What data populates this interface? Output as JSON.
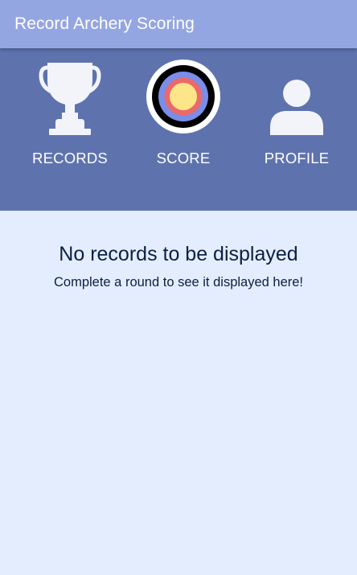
{
  "app": {
    "title": "Record Archery Scoring",
    "colors": {
      "app_bar": "#94a6e2",
      "nav_background": "#5e73ae",
      "content_background": "#e3edfd",
      "icon_fill": "#f3f4fa",
      "target_ring_black": "#000000",
      "target_ring_blue": "#7a8de8",
      "target_ring_red": "#ea6a6a",
      "target_center_gold": "#fde589"
    }
  },
  "nav": {
    "items": [
      {
        "label": "RECORDS",
        "icon": "trophy-icon"
      },
      {
        "label": "SCORE",
        "icon": "archery-target-icon"
      },
      {
        "label": "PROFILE",
        "icon": "person-icon"
      }
    ]
  },
  "content": {
    "empty_title": "No records to be displayed",
    "empty_subtitle": "Complete a round to see it displayed here!"
  }
}
